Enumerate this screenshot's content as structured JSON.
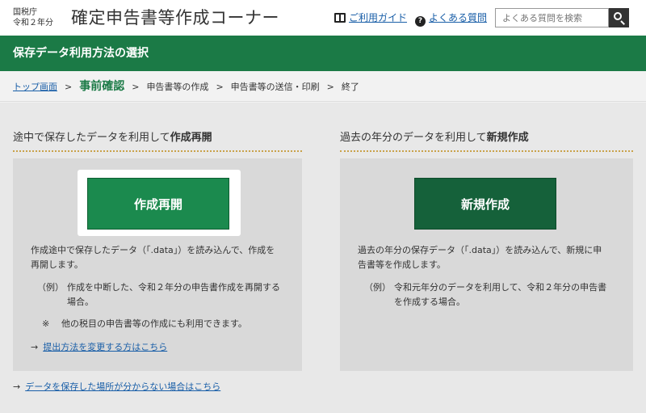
{
  "header": {
    "agency_line1": "国税庁",
    "agency_line2": "令和２年分",
    "site_title": "確定申告書等作成コーナー",
    "guide_link": "ご利用ガイド",
    "faq_link": "よくある質問",
    "search_placeholder": "よくある質問を検索"
  },
  "page_bar": {
    "title": "保存データ利用方法の選択"
  },
  "breadcrumb": {
    "items": [
      "トップ画面",
      "事前確認",
      "申告書等の作成",
      "申告書等の送信・印刷",
      "終了"
    ],
    "separator": ">"
  },
  "left": {
    "heading_plain": "途中で保存したデータを利用して",
    "heading_bold": "作成再開",
    "button_label": "作成再開",
    "desc_line1": "作成途中で保存したデータ（｢.data｣）を読み込んで、作成を",
    "desc_line2": "再開します。",
    "example_tag": "（例）",
    "example_line1": "作成を中断した、令和２年分の申告書作成を再開する",
    "example_line2": "場合。",
    "note_mark": "※",
    "note_text": "他の税目の申告書等の作成にも利用できます。",
    "link_arrow": "→",
    "link_text": "提出方法を変更する方はこちら"
  },
  "right": {
    "heading_plain": "過去の年分のデータを利用して",
    "heading_bold": "新規作成",
    "button_label": "新規作成",
    "desc_line1": "過去の年分の保存データ（｢.data｣）を読み込んで、新規に申",
    "desc_line2": "告書等を作成します。",
    "example_tag": "（例）",
    "example_line1": "令和元年分のデータを利用して、令和２年分の申告書",
    "example_line2": "を作成する場合。"
  },
  "footer_link": {
    "arrow": "→",
    "text": "データを保存した場所が分からない場合はこちら"
  }
}
